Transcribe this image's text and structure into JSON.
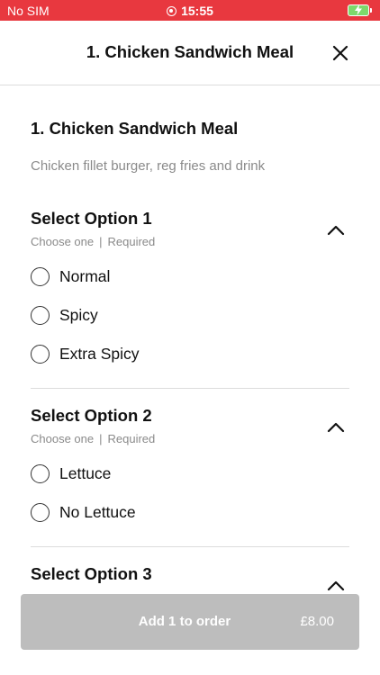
{
  "status_bar": {
    "carrier": "No SIM",
    "time": "15:55",
    "color": "#e8383f"
  },
  "header": {
    "title": "1. Chicken Sandwich Meal"
  },
  "item": {
    "title": "1. Chicken Sandwich Meal",
    "description": "Chicken fillet burger, reg fries and drink"
  },
  "groups": [
    {
      "title": "Select Option 1",
      "choose": "Choose one",
      "separator": "|",
      "required": "Required",
      "options": [
        "Normal",
        "Spicy",
        "Extra Spicy"
      ]
    },
    {
      "title": "Select Option 2",
      "choose": "Choose one",
      "separator": "|",
      "required": "Required",
      "options": [
        "Lettuce",
        "No Lettuce"
      ]
    },
    {
      "title": "Select Option 3"
    }
  ],
  "footer": {
    "add_label": "Add 1 to order",
    "price": "£8.00"
  }
}
